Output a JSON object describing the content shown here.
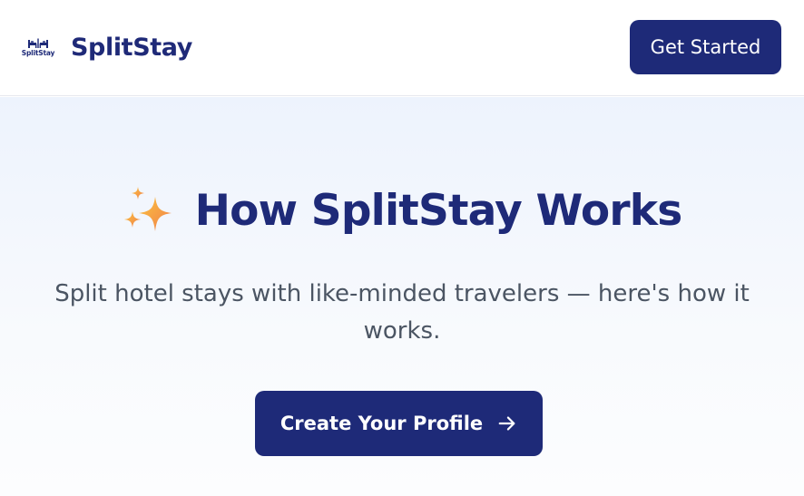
{
  "header": {
    "logo_text": "SplitStay",
    "brand_name": "SplitStay",
    "cta_label": "Get Started"
  },
  "hero": {
    "title_icon": "sparkles-icon",
    "title": "How SplitStay Works",
    "subtitle": "Split hotel stays with like-minded travelers — here's how it works.",
    "cta_label": "Create Your Profile",
    "cta_icon": "arrow-right-icon"
  },
  "colors": {
    "brand": "#1e2a78",
    "subtitle_text": "#4b5563",
    "hero_background_top": "#edf3fd",
    "hero_background_bottom": "#fcfdfe",
    "sparkle_gold": "#f6b73c",
    "sparkle_orange": "#f2844a"
  }
}
